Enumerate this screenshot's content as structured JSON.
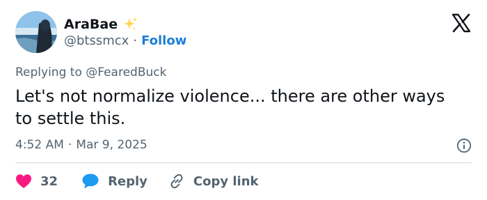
{
  "author": {
    "display_name": "AraBae",
    "handle": "@btssmcx",
    "separator": "·",
    "follow_label": "Follow"
  },
  "reply_context": "Replying to @FearedBuck",
  "tweet": {
    "text": "Let's not normalize violence... there are other ways to settle this.",
    "time": "4:52 AM",
    "time_separator": "·",
    "date": "Mar 9, 2025"
  },
  "actions": {
    "like_count": "32",
    "reply_label": "Reply",
    "copy_link_label": "Copy link"
  },
  "colors": {
    "like": "#f91880",
    "reply": "#1d9bf0",
    "follow": "#1d7fd8",
    "sparkle": "#ffd54a"
  },
  "icons": {
    "brand": "x-logo-icon",
    "badge": "sparkle-icon",
    "like": "heart-icon",
    "reply": "speech-bubble-icon",
    "copy": "link-icon",
    "info": "info-icon"
  }
}
